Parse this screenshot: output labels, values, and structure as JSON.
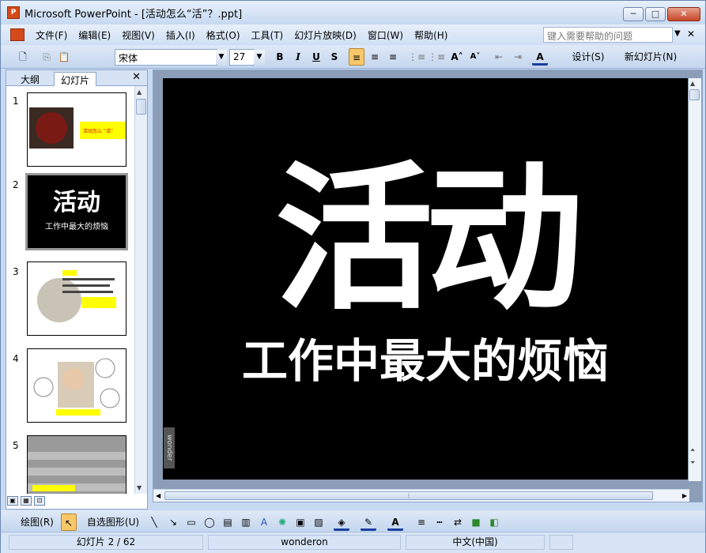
{
  "window": {
    "title": "Microsoft PowerPoint - [活动怎么“活”？.ppt]",
    "app_icon": "powerpoint-icon"
  },
  "menu": {
    "items": [
      "文件(F)",
      "编辑(E)",
      "视图(V)",
      "插入(I)",
      "格式(O)",
      "工具(T)",
      "幻灯片放映(D)",
      "窗口(W)",
      "帮助(H)"
    ],
    "help_placeholder": "键入需要帮助的问题"
  },
  "format_toolbar": {
    "font": "宋体",
    "size": "27",
    "design_label": "设计(S)",
    "new_slide_label": "新幻灯片(N)"
  },
  "left_pane": {
    "tabs": [
      "大纲",
      "幻灯片"
    ],
    "active_tab": "幻灯片",
    "thumbnails": [
      {
        "num": "1"
      },
      {
        "num": "2"
      },
      {
        "num": "3"
      },
      {
        "num": "4"
      },
      {
        "num": "5"
      }
    ],
    "thumb2_title": "活动",
    "thumb2_sub": "工作中最大的烦恼"
  },
  "slide": {
    "title": "活动",
    "subtitle": "工作中最大的烦恼",
    "watermark": "wonder"
  },
  "draw_toolbar": {
    "draw_label": "绘图(R)",
    "autoshape_label": "自选图形(U)"
  },
  "status": {
    "slide_info": "幻灯片 2 / 62",
    "template": "wonderon",
    "language": "中文(中国)"
  },
  "colors": {
    "accent": "#c4d6ee",
    "slide_bg": "#000000",
    "thumb_highlight": "#ffff00"
  }
}
